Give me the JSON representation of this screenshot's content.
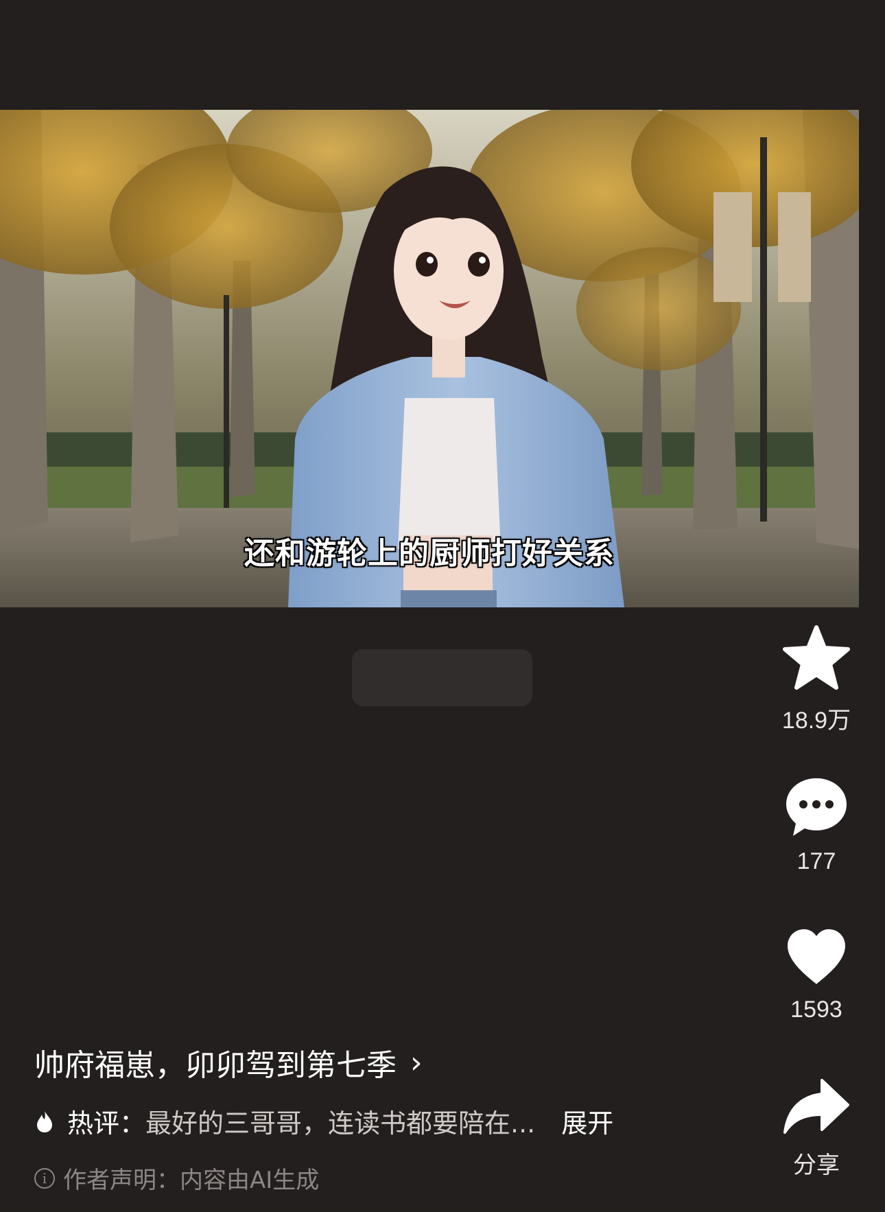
{
  "video": {
    "subtitle": "还和游轮上的厨师打好关系"
  },
  "actions": {
    "favorite": {
      "icon": "star-icon",
      "count": "18.9万"
    },
    "comment": {
      "icon": "comment-bubble-icon",
      "count": "177"
    },
    "like": {
      "icon": "heart-icon",
      "count": "1593"
    },
    "share": {
      "icon": "share-arrow-icon",
      "label": "分享"
    }
  },
  "info": {
    "title": "帅府福崽，卯卯驾到第七季",
    "title_chevron": "›",
    "hot_comment_label": "热评：",
    "hot_comment_text": "最好的三哥哥，连读书都要陪在...",
    "expand_label": "展开",
    "notice_text": "作者声明：内容由AI生成"
  },
  "colors": {
    "background": "#231f1e",
    "text_primary": "#ffffff",
    "text_secondary": "#cfcac7",
    "text_muted": "#8c8785"
  }
}
